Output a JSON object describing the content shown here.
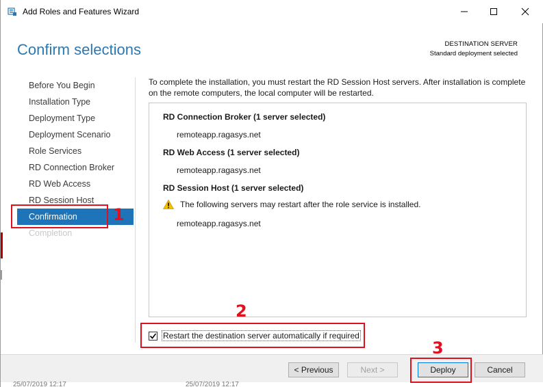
{
  "window": {
    "title": "Add Roles and Features Wizard"
  },
  "header": {
    "page_title": "Confirm selections",
    "destination_label": "DESTINATION SERVER",
    "destination_value": "Standard deployment selected"
  },
  "nav": {
    "items": [
      {
        "label": "Before You Begin"
      },
      {
        "label": "Installation Type"
      },
      {
        "label": "Deployment Type"
      },
      {
        "label": "Deployment Scenario"
      },
      {
        "label": "Role Services"
      },
      {
        "label": "RD Connection Broker"
      },
      {
        "label": "RD Web Access"
      },
      {
        "label": "RD Session Host"
      },
      {
        "label": "Confirmation"
      },
      {
        "label": "Completion"
      }
    ],
    "active": "Confirmation"
  },
  "main": {
    "intro": "To complete the installation, you must restart the RD Session Host servers. After installation is complete on the remote computers, the local computer will be restarted.",
    "roles": [
      {
        "title": "RD Connection Broker  (1 server selected)",
        "server": "remoteapp.ragasys.net"
      },
      {
        "title": "RD Web Access  (1 server selected)",
        "server": "remoteapp.ragasys.net"
      },
      {
        "title": "RD Session Host  (1 server selected)",
        "warning": "The following servers may restart after the role service is installed.",
        "server": "remoteapp.ragasys.net"
      }
    ],
    "restart_label": "Restart the destination server automatically if required",
    "restart_checked": true
  },
  "buttons": {
    "previous": "< Previous",
    "next": "Next >",
    "deploy": "Deploy",
    "cancel": "Cancel"
  },
  "annotations": [
    "1",
    "2",
    "3"
  ],
  "background": {
    "timestamp_left": "25/07/2019 12:17",
    "timestamp_right": "25/07/2019 12:17"
  },
  "colors": {
    "accent": "#1e74b8",
    "title": "#2c78b2",
    "annotation": "#e0101e",
    "warning": "#f2c200"
  }
}
